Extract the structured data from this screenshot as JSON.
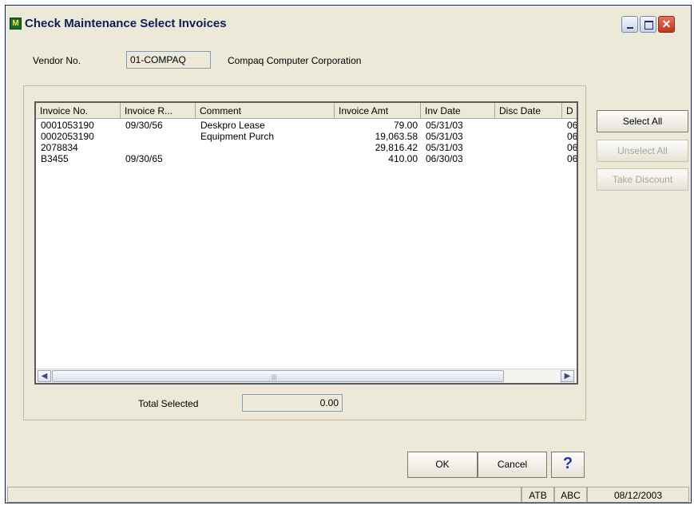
{
  "window": {
    "title": "Check Maintenance Select Invoices"
  },
  "vendor": {
    "label": "Vendor No.",
    "number": "01-COMPAQ",
    "name": "Compaq Computer Corporation"
  },
  "invoices": {
    "columns": [
      "Invoice No.",
      "Invoice R...",
      "Comment",
      "Invoice Amt",
      "Inv Date",
      "Disc Date",
      "D"
    ],
    "rows": [
      {
        "invoice_no": "0001053190",
        "invoice_r": "09/30/56",
        "comment": "Deskpro Lease",
        "amount": "79.00",
        "inv_date": "05/31/03",
        "disc_date": "",
        "d": "06"
      },
      {
        "invoice_no": "0002053190",
        "invoice_r": "",
        "comment": "Equipment Purch",
        "amount": "19,063.58",
        "inv_date": "05/31/03",
        "disc_date": "",
        "d": "06"
      },
      {
        "invoice_no": "2078834",
        "invoice_r": "",
        "comment": "",
        "amount": "29,816.42",
        "inv_date": "05/31/03",
        "disc_date": "",
        "d": "06"
      },
      {
        "invoice_no": "B3455",
        "invoice_r": "09/30/65",
        "comment": "",
        "amount": "410.00",
        "inv_date": "06/30/03",
        "disc_date": "",
        "d": "06"
      }
    ]
  },
  "total": {
    "label": "Total Selected",
    "value": "0.00"
  },
  "side_buttons": {
    "select_all": "Select All",
    "unselect_all": "Unselect All",
    "take_discount": "Take Discount"
  },
  "buttons": {
    "ok": "OK",
    "cancel": "Cancel",
    "help": "?"
  },
  "status": {
    "main": "",
    "p1": "ATB",
    "p2": "ABC",
    "date": "08/12/2003"
  },
  "icons": {
    "app": "app-icon",
    "min": "minimize-icon",
    "max": "maximize-icon",
    "close": "close-icon",
    "left": "scroll-left-icon",
    "right": "scroll-right-icon"
  }
}
